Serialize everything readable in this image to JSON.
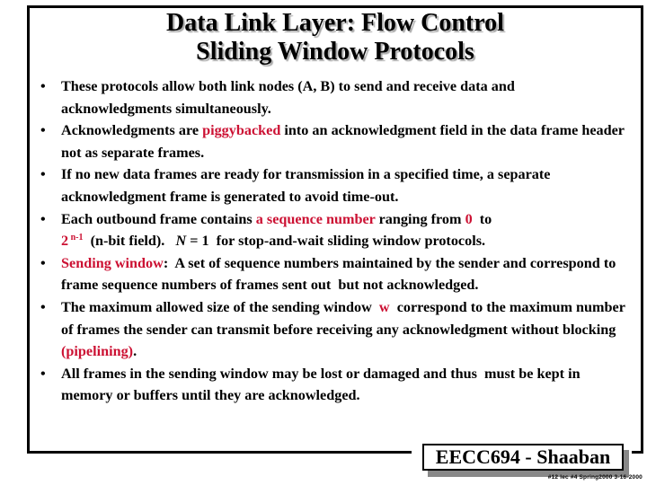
{
  "slide": {
    "title_lines": [
      "Data Link Layer:  Flow Control",
      "Sliding Window Protocols"
    ],
    "accent_color": "#cc1133",
    "bullet_glyph": "•",
    "bullets": [
      {
        "parts": [
          {
            "text": "These protocols allow both link nodes (A, B) to send and receive data and acknowledgments simultaneously.",
            "style": "normal"
          }
        ]
      },
      {
        "parts": [
          {
            "text": "Acknowledgments are ",
            "style": "normal"
          },
          {
            "text": "piggybacked",
            "style": "red"
          },
          {
            "text": " into an acknowledgment field in the data frame header not as separate frames.",
            "style": "normal"
          }
        ]
      },
      {
        "parts": [
          {
            "text": "If no new data frames are ready for transmission in a specified time, a separate acknowledgment frame is generated to avoid time-out.",
            "style": "normal"
          }
        ]
      },
      {
        "parts": [
          {
            "text": "Each outbound frame contains ",
            "style": "normal"
          },
          {
            "text": "a sequence number",
            "style": "red"
          },
          {
            "text": " ranging from ",
            "style": "normal"
          },
          {
            "text": "0",
            "style": "red"
          },
          {
            "text": "  to ",
            "style": "normal"
          },
          {
            "text": "2",
            "style": "red",
            "br_before": true
          },
          {
            "text": " n-1",
            "style": "red-sup"
          },
          {
            "text": "  (n-bit field).   ",
            "style": "normal"
          },
          {
            "text": "N",
            "style": "italic"
          },
          {
            "text": " = 1  for stop-and-wait sliding window protocols.",
            "style": "normal"
          }
        ]
      },
      {
        "parts": [
          {
            "text": "Sending window",
            "style": "red"
          },
          {
            "text": ":  A set of sequence numbers maintained by the sender and correspond to frame sequence numbers of frames sent out  but not acknowledged.",
            "style": "normal"
          }
        ]
      },
      {
        "parts": [
          {
            "text": "The maximum allowed size of the sending window  ",
            "style": "normal"
          },
          {
            "text": "w",
            "style": "red"
          },
          {
            "text": "  correspond to the maximum number of frames the sender can transmit before receiving any acknowledgment without blocking  ",
            "style": "normal"
          },
          {
            "text": "(pipelining)",
            "style": "red"
          },
          {
            "text": ".",
            "style": "normal"
          }
        ]
      },
      {
        "parts": [
          {
            "text": "All frames in the sending window may be lost or damaged and thus  must be kept in memory or buffers until they are acknowledged.",
            "style": "normal"
          }
        ]
      }
    ]
  },
  "footer": {
    "badge_label": "EECC694 - Shaaban",
    "note": "#12  lec #4  Spring2000  3-16-2000"
  }
}
